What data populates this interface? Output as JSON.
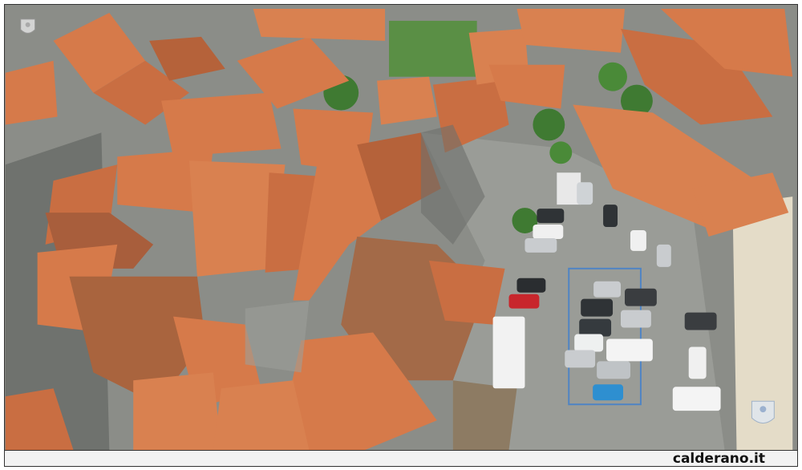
{
  "image": {
    "subject": "aerial-town-rooftops-and-parking",
    "watermark": "calderano.it",
    "colors": {
      "roof": "#d67a4a",
      "roof_dark": "#b5623a",
      "plaza": "#9a9c97",
      "street": "#7d7f7b",
      "tree": "#3f7a32",
      "wall": "#e8d6b0"
    }
  },
  "icons": [
    "town-crest-logo",
    "town-crest-logo-faded"
  ]
}
